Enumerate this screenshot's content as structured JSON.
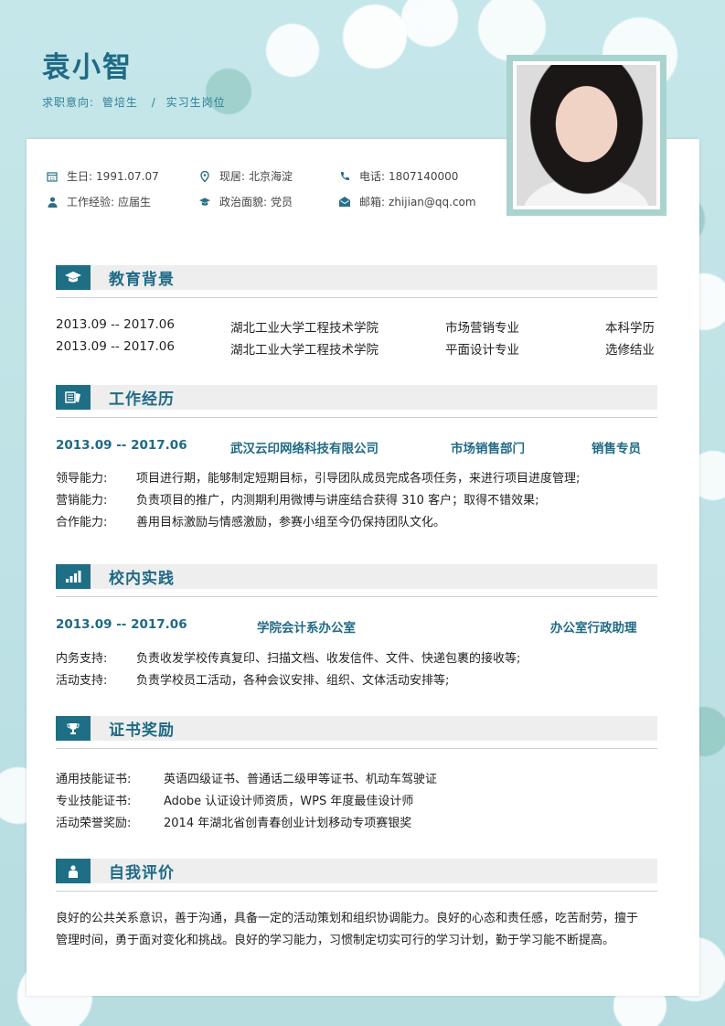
{
  "header": {
    "name": "袁小智",
    "intention_label": "求职意向:",
    "intention_role1": "管培生",
    "intention_sep": "/",
    "intention_role2": "实习生岗位"
  },
  "info": {
    "birth_label": "生日:",
    "birth_value": "1991.07.07",
    "residence_label": "现居:",
    "residence_value": "北京海淀",
    "phone_label": "电话:",
    "phone_value": "1807140000",
    "experience_label": "工作经验:",
    "experience_value": "应届生",
    "politics_label": "政治面貌:",
    "politics_value": "党员",
    "email_label": "邮箱:",
    "email_value": "zhijian@qq.com"
  },
  "education": {
    "title": "教育背景",
    "rows": [
      {
        "period": "2013.09 -- 2017.06",
        "school": "湖北工业大学工程技术学院",
        "major": "市场营销专业",
        "degree": "本科学历"
      },
      {
        "period": "2013.09 -- 2017.06",
        "school": "湖北工业大学工程技术学院",
        "major": "平面设计专业",
        "degree": "选修结业"
      }
    ]
  },
  "work": {
    "title": "工作经历",
    "period": "2013.09 -- 2017.06",
    "company": "武汉云印网络科技有限公司",
    "dept": "市场销售部门",
    "role": "销售专员",
    "items": [
      {
        "k": "领导能力:",
        "v": "项目进行期，能够制定短期目标，引导团队成员完成各项任务，来进行项目进度管理;"
      },
      {
        "k": "营销能力:",
        "v": "负责项目的推广，内测期利用微博与讲座结合获得 310 客户；取得不错效果;"
      },
      {
        "k": "合作能力:",
        "v": "善用目标激励与情感激励，参赛小组至今仍保持团队文化。"
      }
    ]
  },
  "campus": {
    "title": "校内实践",
    "period": "2013.09 -- 2017.06",
    "org": "学院会计系办公室",
    "role": "办公室行政助理",
    "items": [
      {
        "k": "内务支持:",
        "v": "负责收发学校传真复印、扫描文档、收发信件、文件、快递包裹的接收等;"
      },
      {
        "k": "活动支持:",
        "v": "负责学校员工活动，各种会议安排、组织、文体活动安排等;"
      }
    ]
  },
  "certs": {
    "title": "证书奖励",
    "items": [
      {
        "k": "通用技能证书:",
        "v": "英语四级证书、普通话二级甲等证书、机动车驾驶证"
      },
      {
        "k": "专业技能证书:",
        "v": "Adobe 认证设计师资质，WPS 年度最佳设计师"
      },
      {
        "k": "活动荣誉奖励:",
        "v": "2014 年湖北省创青春创业计划移动专项赛银奖"
      }
    ]
  },
  "self": {
    "title": "自我评价",
    "text": "良好的公共关系意识，善于沟通，具备一定的活动策划和组织协调能力。良好的心态和责任感，吃苦耐劳，擅于管理时间，勇于面对变化和挑战。良好的学习能力，习惯制定切实可行的学习计划，勤于学习能不断提高。"
  },
  "icons": {
    "education": "graduation-cap-icon",
    "work": "book-icon",
    "campus": "bar-chart-icon",
    "certs": "trophy-icon",
    "self": "person-icon"
  },
  "colors": {
    "accent": "#1e6f86",
    "title": "#1f6a85",
    "background": "#bfe3e6"
  }
}
